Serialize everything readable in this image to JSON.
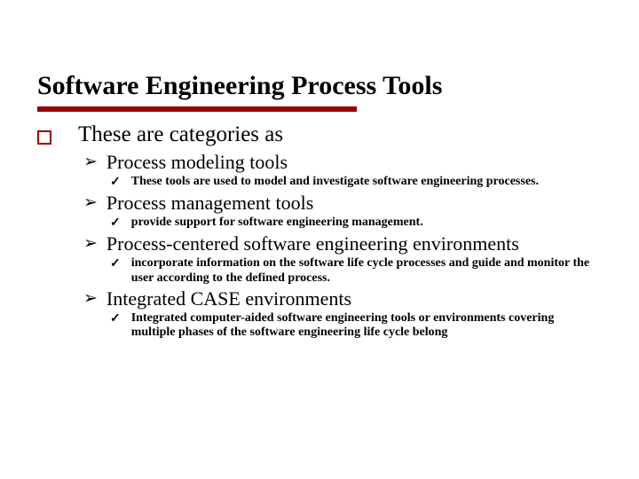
{
  "title": "Software Engineering Process Tools",
  "lvl1_text": "These are categories as",
  "items": [
    {
      "label": "Process modeling tools",
      "details": [
        " These tools are used to model and investigate software engineering processes."
      ]
    },
    {
      "label": "Process management tools",
      "details": [
        "provide support for software engineering management."
      ]
    },
    {
      "label": "Process-centered software engineering environments",
      "details": [
        "incorporate information on the software life cycle processes and guide and monitor the user according to the defined process."
      ]
    },
    {
      "label": "Integrated CASE environments",
      "details": [
        "Integrated computer-aided software engineering tools or environments covering multiple phases of the software engineering life cycle belong"
      ]
    }
  ]
}
